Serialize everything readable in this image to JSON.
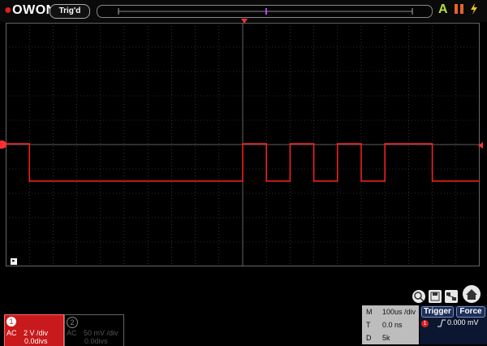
{
  "app": {
    "brand": "OWON",
    "trigger_status": "Trig'd",
    "auto_label": "A",
    "run_stop_icon": "pause-icon",
    "lightning_icon": "lightning-icon"
  },
  "colors": {
    "accent": "#c8191c",
    "grid": "#555555",
    "waveform": "#ff2020",
    "auto": "#b6e03a",
    "run": "#e8632a",
    "lightning": "#f0c020"
  },
  "waveform": {
    "levels": [
      "high",
      "low"
    ],
    "segments": [
      {
        "from": 0.0,
        "to": 0.05,
        "level": "high"
      },
      {
        "from": 0.05,
        "to": 0.5,
        "level": "low"
      },
      {
        "from": 0.5,
        "to": 0.55,
        "level": "high"
      },
      {
        "from": 0.55,
        "to": 0.6,
        "level": "low"
      },
      {
        "from": 0.6,
        "to": 0.65,
        "level": "high"
      },
      {
        "from": 0.65,
        "to": 0.7,
        "level": "low"
      },
      {
        "from": 0.7,
        "to": 0.75,
        "level": "high"
      },
      {
        "from": 0.75,
        "to": 0.8,
        "level": "low"
      },
      {
        "from": 0.8,
        "to": 0.9,
        "level": "high"
      },
      {
        "from": 0.9,
        "to": 1.0,
        "level": "low"
      }
    ]
  },
  "channels": [
    {
      "number": "1",
      "coupling": "AC",
      "volts_div": "2 V /div",
      "offset": "0.0divs"
    },
    {
      "number": "2",
      "coupling": "AC",
      "volts_div": "50 mV /div",
      "offset": "0.0divs"
    }
  ],
  "timebase": {
    "M_label": "M",
    "M_value": "100us /div",
    "T_label": "T",
    "T_value": "0.0 ns",
    "D_label": "D",
    "D_value": "5k"
  },
  "trigger": {
    "trigger_label": "Trigger",
    "force_label": "Force",
    "channel": "1",
    "slope_icon": "rising-edge-icon",
    "level": "0.000 mV"
  },
  "tools": [
    "search-icon",
    "save-icon",
    "network-icon",
    "home-icon"
  ]
}
